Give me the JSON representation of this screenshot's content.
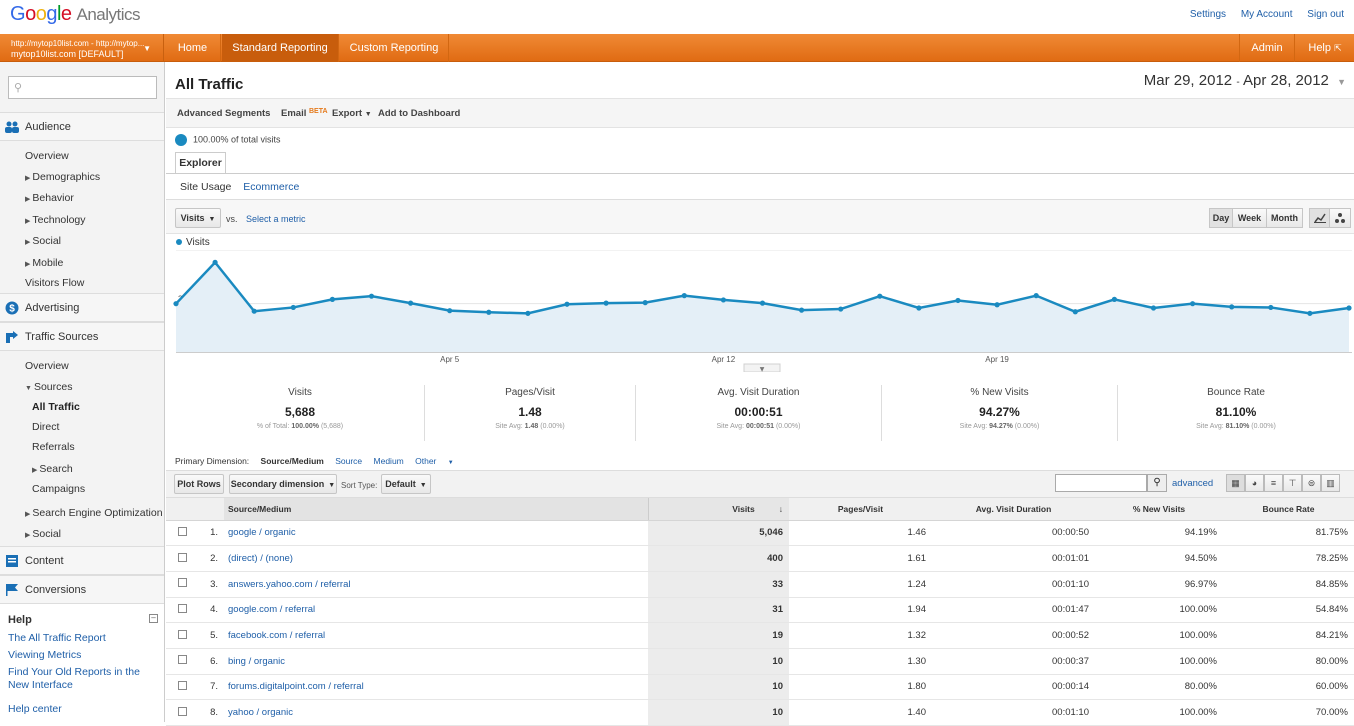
{
  "header": {
    "logo_letters": [
      "G",
      "o",
      "o",
      "g",
      "l",
      "e"
    ],
    "logo_product": "Analytics",
    "links": [
      "Settings",
      "My Account",
      "Sign out"
    ]
  },
  "account": {
    "urls": "http://mytop10list.com - http://mytop...",
    "name": "mytop10list.com [DEFAULT]"
  },
  "nav": {
    "items": [
      "Home",
      "Standard Reporting",
      "Custom Reporting"
    ],
    "right_items": [
      "Admin",
      "Help"
    ]
  },
  "sidebar": {
    "search_placeholder": "",
    "audience": "Audience",
    "audience_items": [
      "Overview",
      "Demographics",
      "Behavior",
      "Technology",
      "Social",
      "Mobile",
      "Visitors Flow"
    ],
    "advertising": "Advertising",
    "traffic_sources": "Traffic Sources",
    "traffic_items": {
      "overview": "Overview",
      "sources": "Sources",
      "all_traffic": "All Traffic",
      "direct": "Direct",
      "referrals": "Referrals",
      "search": "Search",
      "campaigns": "Campaigns",
      "seo": "Search Engine Optimization",
      "social": "Social"
    },
    "content": "Content",
    "conversions": "Conversions",
    "help": {
      "title": "Help",
      "links": [
        "The All Traffic Report",
        "Viewing Metrics",
        "Find Your Old Reports in the New Interface",
        "Help center"
      ]
    }
  },
  "report": {
    "title": "All Traffic",
    "date_start": "Mar 29, 2012",
    "date_sep": "-",
    "date_end": "Apr 28, 2012",
    "toolbar": {
      "advanced_segments": "Advanced Segments",
      "email": "Email",
      "beta": "BETA",
      "export": "Export",
      "add_to_dashboard": "Add to Dashboard"
    },
    "segment": "100.00% of total visits",
    "tab": "Explorer",
    "subtabs": [
      "Site Usage",
      "Ecommerce"
    ],
    "metric_select": "Visits",
    "vs": "vs.",
    "select_metric": "Select a metric",
    "granularity": [
      "Day",
      "Week",
      "Month"
    ],
    "active_granularity": "Day"
  },
  "chart_data": {
    "type": "area",
    "series": [
      {
        "name": "Visits",
        "values": [
          200,
          277,
          186,
          193,
          208,
          214,
          201,
          187,
          184,
          182,
          199,
          201,
          202,
          215,
          207,
          201,
          188,
          190,
          214,
          192,
          206,
          198,
          215,
          185,
          208,
          192,
          200,
          194,
          193,
          182,
          192
        ]
      }
    ],
    "x": [
      "Mar 29",
      "Mar 30",
      "Mar 31",
      "Apr 1",
      "Apr 2",
      "Apr 3",
      "Apr 4",
      "Apr 5",
      "Apr 6",
      "Apr 7",
      "Apr 8",
      "Apr 9",
      "Apr 10",
      "Apr 11",
      "Apr 12",
      "Apr 13",
      "Apr 14",
      "Apr 15",
      "Apr 16",
      "Apr 17",
      "Apr 18",
      "Apr 19",
      "Apr 20",
      "Apr 21",
      "Apr 22",
      "Apr 23",
      "Apr 24",
      "Apr 25",
      "Apr 26",
      "Apr 27",
      "Apr 28"
    ],
    "x_tick_labels": [
      {
        "label": "Apr 5",
        "index": 7
      },
      {
        "label": "Apr 12",
        "index": 14
      },
      {
        "label": "Apr 19",
        "index": 21
      }
    ],
    "y_ticks": [
      300,
      200
    ],
    "ylim": [
      110,
      300
    ],
    "legend": "top-left",
    "color": "#1a8ac0",
    "fill": "#e4eff7"
  },
  "scorecards": [
    {
      "name": "Visits",
      "value": "5,688",
      "sub_prefix": "% of Total: ",
      "sub_bold": "100.00%",
      "sub_suffix": " (5,688)"
    },
    {
      "name": "Pages/Visit",
      "value": "1.48",
      "sub_prefix": "Site Avg: ",
      "sub_bold": "1.48",
      "sub_suffix": " (0.00%)"
    },
    {
      "name": "Avg. Visit Duration",
      "value": "00:00:51",
      "sub_prefix": "Site Avg: ",
      "sub_bold": "00:00:51",
      "sub_suffix": " (0.00%)"
    },
    {
      "name": "% New Visits",
      "value": "94.27%",
      "sub_prefix": "Site Avg: ",
      "sub_bold": "94.27%",
      "sub_suffix": " (0.00%)"
    },
    {
      "name": "Bounce Rate",
      "value": "81.10%",
      "sub_prefix": "Site Avg: ",
      "sub_bold": "81.10%",
      "sub_suffix": " (0.00%)"
    }
  ],
  "dimension": {
    "label": "Primary Dimension:",
    "current": "Source/Medium",
    "options": [
      "Source",
      "Medium",
      "Other"
    ]
  },
  "table_controls": {
    "plot_rows": "Plot Rows",
    "secondary_dimension": "Secondary dimension",
    "sort_type_label": "Sort Type:",
    "sort_type": "Default",
    "search_value": "",
    "advanced": "advanced"
  },
  "table": {
    "headers": [
      "Source/Medium",
      "Visits",
      "Pages/Visit",
      "Avg. Visit Duration",
      "% New Visits",
      "Bounce Rate"
    ],
    "rows": [
      {
        "idx": "1.",
        "source": "google / organic",
        "visits": "5,046",
        "ppv": "1.46",
        "dur": "00:00:50",
        "newv": "94.19%",
        "bounce": "81.75%"
      },
      {
        "idx": "2.",
        "source": "(direct) / (none)",
        "visits": "400",
        "ppv": "1.61",
        "dur": "00:01:01",
        "newv": "94.50%",
        "bounce": "78.25%"
      },
      {
        "idx": "3.",
        "source": "answers.yahoo.com / referral",
        "visits": "33",
        "ppv": "1.24",
        "dur": "00:01:10",
        "newv": "96.97%",
        "bounce": "84.85%"
      },
      {
        "idx": "4.",
        "source": "google.com / referral",
        "visits": "31",
        "ppv": "1.94",
        "dur": "00:01:47",
        "newv": "100.00%",
        "bounce": "54.84%"
      },
      {
        "idx": "5.",
        "source": "facebook.com / referral",
        "visits": "19",
        "ppv": "1.32",
        "dur": "00:00:52",
        "newv": "100.00%",
        "bounce": "84.21%"
      },
      {
        "idx": "6.",
        "source": "bing / organic",
        "visits": "10",
        "ppv": "1.30",
        "dur": "00:00:37",
        "newv": "100.00%",
        "bounce": "80.00%"
      },
      {
        "idx": "7.",
        "source": "forums.digitalpoint.com / referral",
        "visits": "10",
        "ppv": "1.80",
        "dur": "00:00:14",
        "newv": "80.00%",
        "bounce": "60.00%"
      },
      {
        "idx": "8.",
        "source": "yahoo / organic",
        "visits": "10",
        "ppv": "1.40",
        "dur": "00:01:10",
        "newv": "100.00%",
        "bounce": "70.00%"
      }
    ]
  }
}
